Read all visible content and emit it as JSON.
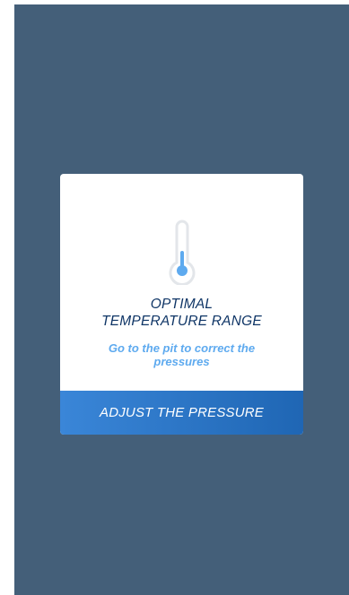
{
  "alert": {
    "title_line1": "OPTIMAL",
    "title_line2": "TEMPERATURE RANGE",
    "message": "Go to the pit to correct the pressures",
    "button_label": "ADJUST THE PRESSURE",
    "icon": "thermometer-icon"
  },
  "colors": {
    "background": "#445f79",
    "title": "#0f3566",
    "message": "#5eaaef",
    "button_start": "#3a86d8",
    "button_end": "#1f66b4",
    "thermometer_fill": "#5eaaef",
    "thermometer_outline": "#e3e6ea"
  }
}
